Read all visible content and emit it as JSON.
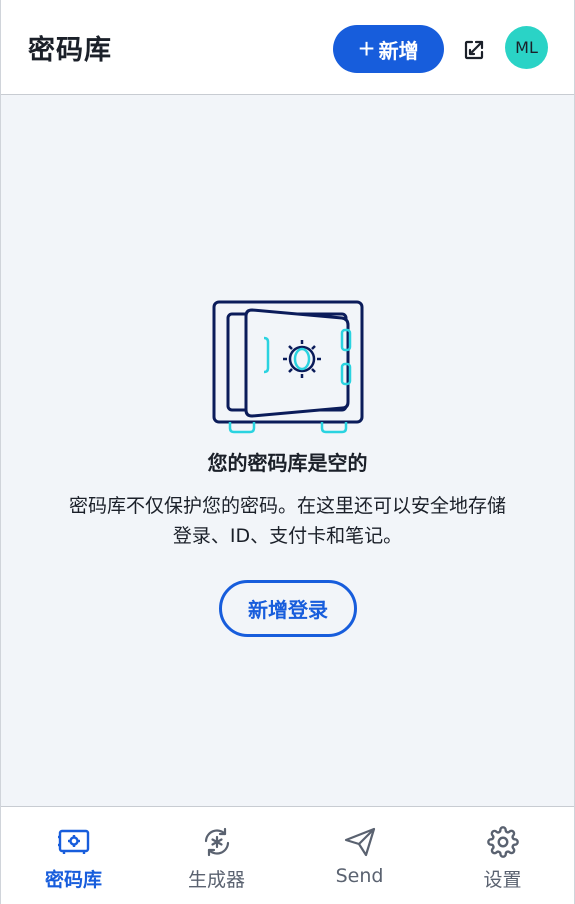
{
  "header": {
    "title": "密码库",
    "new_label": "新增",
    "avatar_initials": "ML"
  },
  "main": {
    "empty_title": "您的密码库是空的",
    "empty_description_line1": "密码库不仅保护您的密码。在这里还可以安全地存储",
    "empty_description_line2": "登录、ID、支付卡和笔记。",
    "add_login_label": "新增登录"
  },
  "nav": {
    "items": [
      {
        "label": "密码库",
        "icon": "vault-icon",
        "active": true
      },
      {
        "label": "生成器",
        "icon": "generator-icon",
        "active": false
      },
      {
        "label": "Send",
        "icon": "send-icon",
        "active": false
      },
      {
        "label": "设置",
        "icon": "gear-icon",
        "active": false
      }
    ]
  },
  "colors": {
    "primary": "#175ddc",
    "avatar": "#2ad3c6",
    "text": "#1b2029",
    "muted": "#5a6270",
    "background": "#f2f5f9",
    "illustration_dark": "#0b1c5a",
    "illustration_accent": "#2ad3e0"
  }
}
